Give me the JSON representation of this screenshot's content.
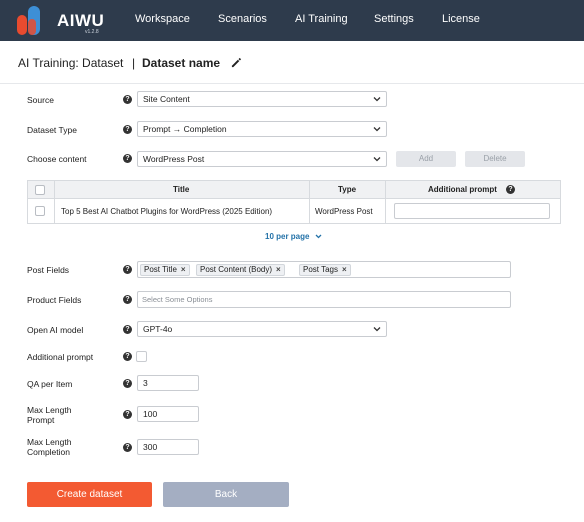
{
  "app": {
    "name": "AIWU",
    "version": "v1.2.8",
    "colors": {
      "topbar": "#2e3b4c",
      "accent": "#f35a32",
      "secondary_button": "#a4aec2",
      "link": "#2372a8"
    }
  },
  "nav": {
    "items": [
      {
        "label": "Workspace"
      },
      {
        "label": "Scenarios"
      },
      {
        "label": "AI Training"
      },
      {
        "label": "Settings"
      },
      {
        "label": "License"
      }
    ]
  },
  "header": {
    "breadcrumb": "AI Training: Dataset",
    "separator": "|",
    "dataset_name": "Dataset name",
    "edit_icon": "pencil-icon"
  },
  "form": {
    "source": {
      "label": "Source",
      "value": "Site Content"
    },
    "dataset_type": {
      "label": "Dataset Type",
      "value": "Prompt → Completion"
    },
    "choose_content": {
      "label": "Choose content",
      "value": "WordPress Post",
      "add_label": "Add",
      "delete_label": "Delete"
    },
    "table": {
      "columns": [
        "",
        "Title",
        "Type",
        "Additional prompt"
      ],
      "rows": [
        {
          "title": "Top 5 Best AI Chatbot Plugins for WordPress (2025 Edition)",
          "type": "WordPress Post",
          "prompt": ""
        }
      ],
      "per_page": "10 per page"
    },
    "post_fields": {
      "label": "Post Fields",
      "chips": [
        "Post Title",
        "Post Content (Body)",
        "Post Tags"
      ]
    },
    "product_fields": {
      "label": "Product Fields",
      "placeholder": "Select Some Options"
    },
    "openai_model": {
      "label": "Open AI model",
      "value": "GPT-4o"
    },
    "additional_prompt": {
      "label": "Additional prompt",
      "checked": false
    },
    "qa_per_item": {
      "label": "QA per Item",
      "value": "3"
    },
    "max_length_prompt": {
      "label_line1": "Max Length",
      "label_line2": "Prompt",
      "value": "100"
    },
    "max_length_completion": {
      "label_line1": "Max Length",
      "label_line2": "Completion",
      "value": "300"
    },
    "help_icon": "?"
  },
  "actions": {
    "create_label": "Create dataset",
    "back_label": "Back"
  }
}
